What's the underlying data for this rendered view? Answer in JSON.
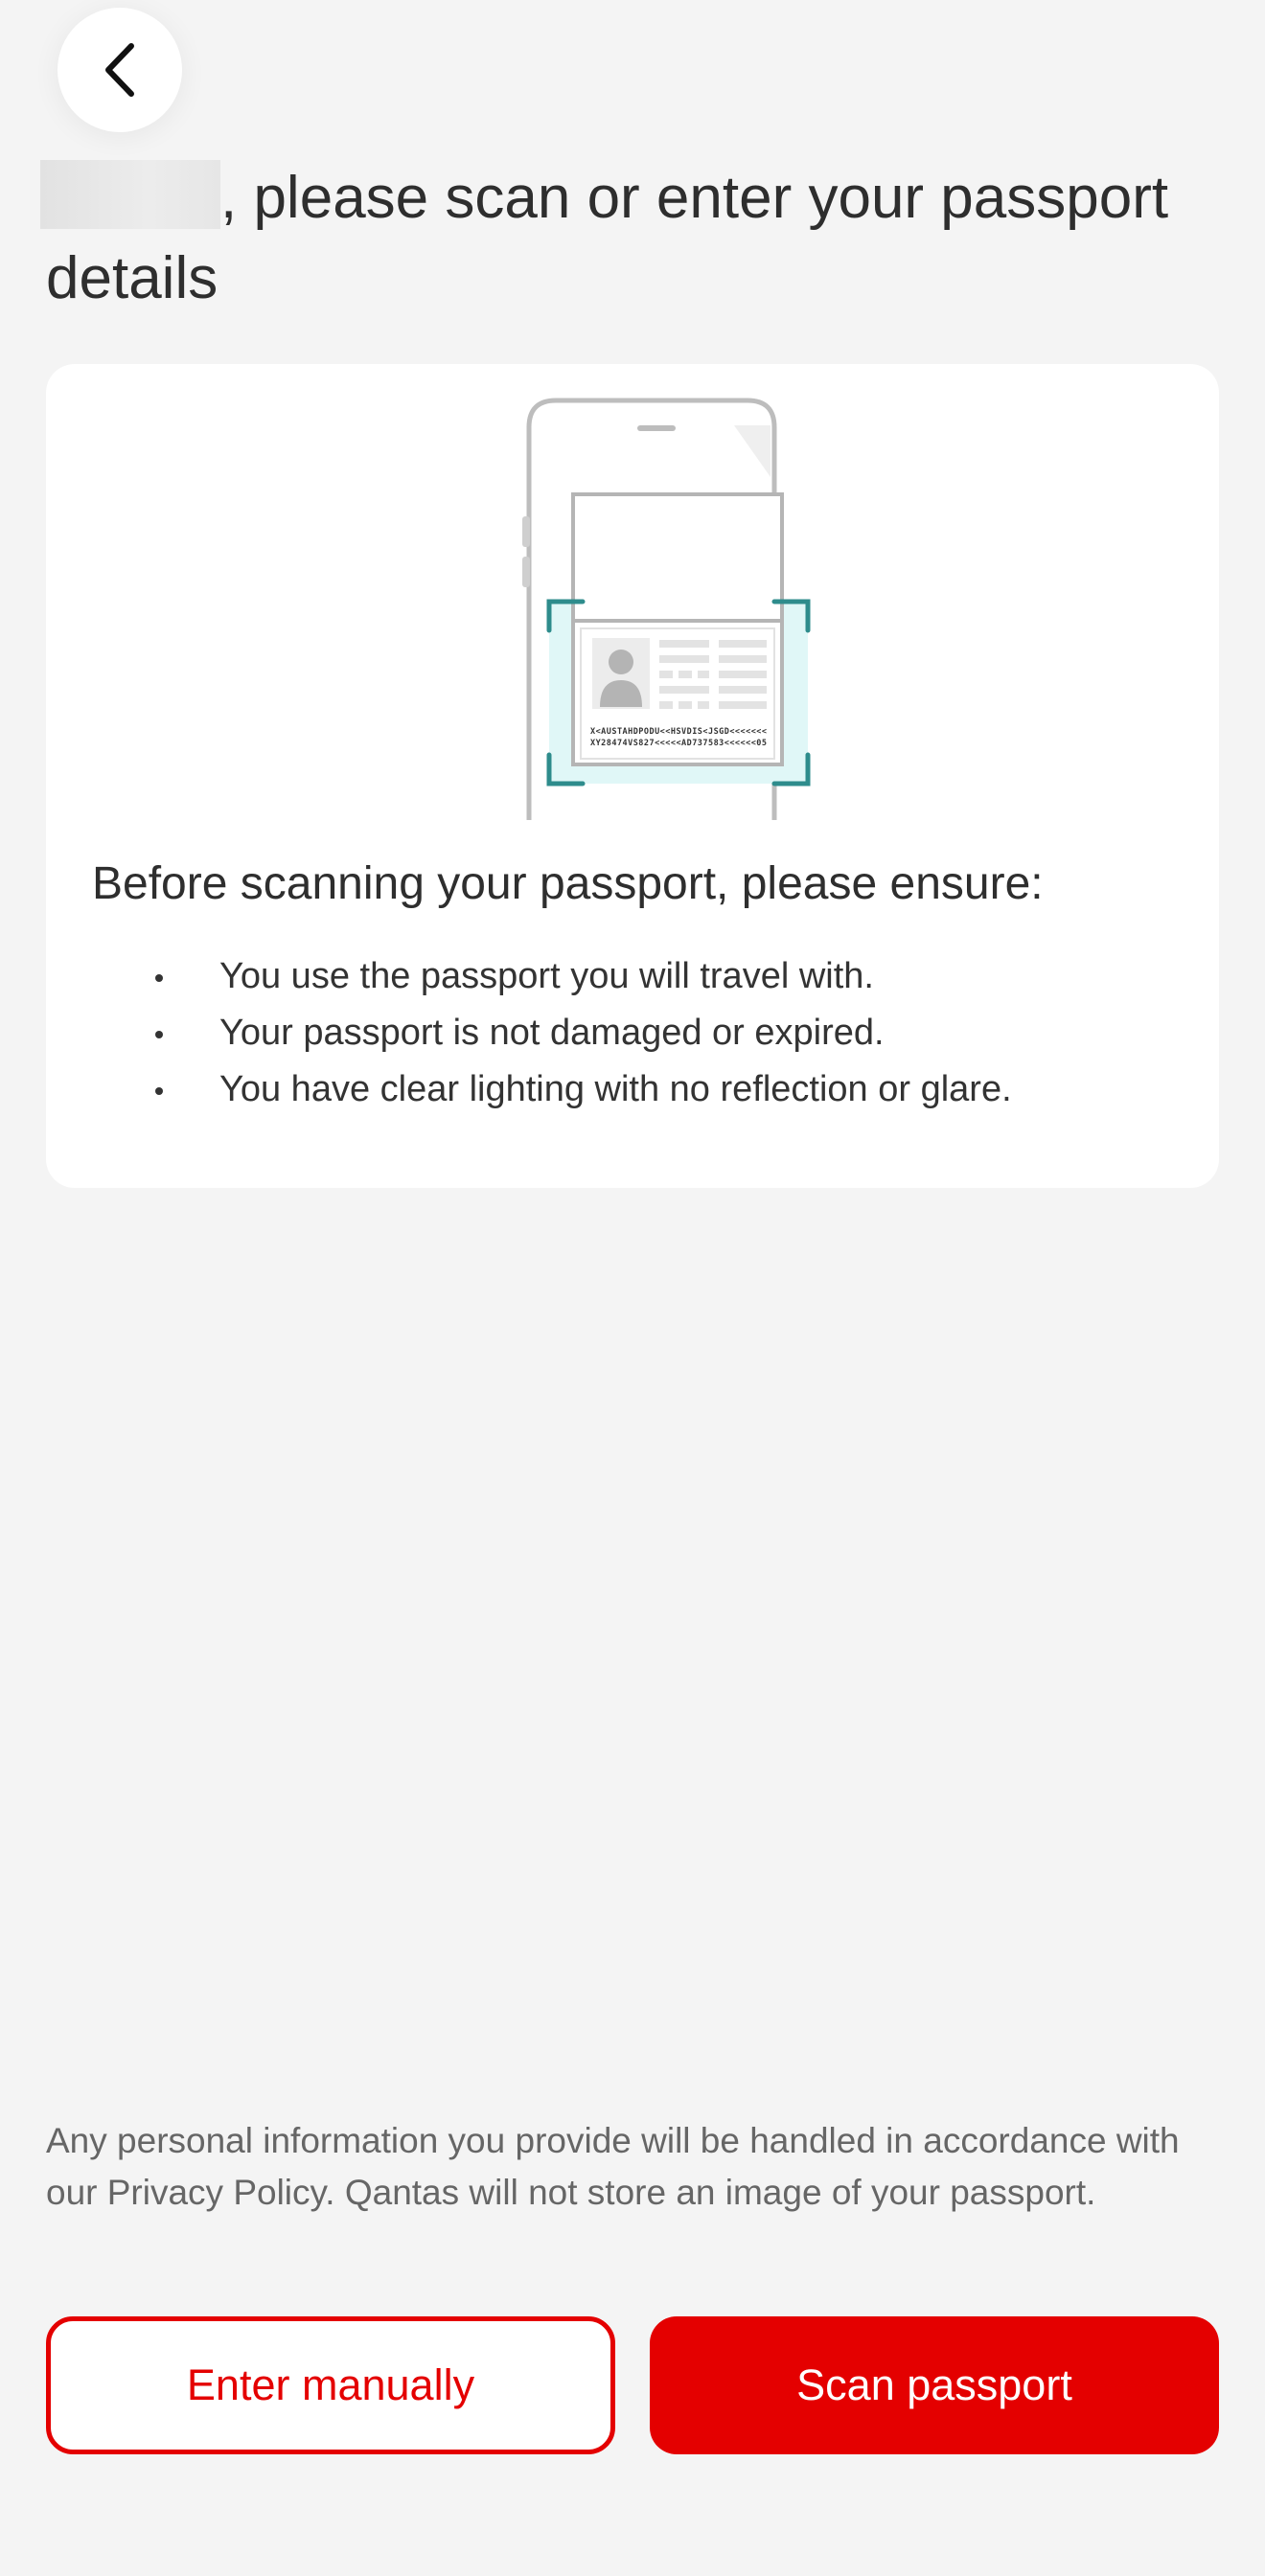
{
  "header": {
    "back_icon": "chevron-left-icon"
  },
  "title": {
    "text": ", please scan or enter your passport details"
  },
  "card": {
    "illustration": {
      "name": "phone-scanning-passport-illustration",
      "mrz_line_1": "X<AUSTAHDPODU<<HSVDIS<JSGD<<<<<<<",
      "mrz_line_2": "XY28474VS827<<<<<AD737583<<<<<<05"
    },
    "heading": "Before scanning your passport, please ensure:",
    "checklist": [
      "You use the passport you will travel with.",
      "Your passport is not damaged or expired.",
      "You have clear lighting with no reflection or glare."
    ]
  },
  "footer": {
    "privacy_text": "Any personal information you provide will be handled in accordance with our Privacy Policy. Qantas will not store an image of your passport.",
    "enter_manually_label": "Enter manually",
    "scan_passport_label": "Scan passport"
  },
  "colors": {
    "brand_red": "#e40000",
    "scan_teal": "#2e8c8c",
    "scan_highlight": "#e0f7f7",
    "background": "#f4f4f4"
  }
}
